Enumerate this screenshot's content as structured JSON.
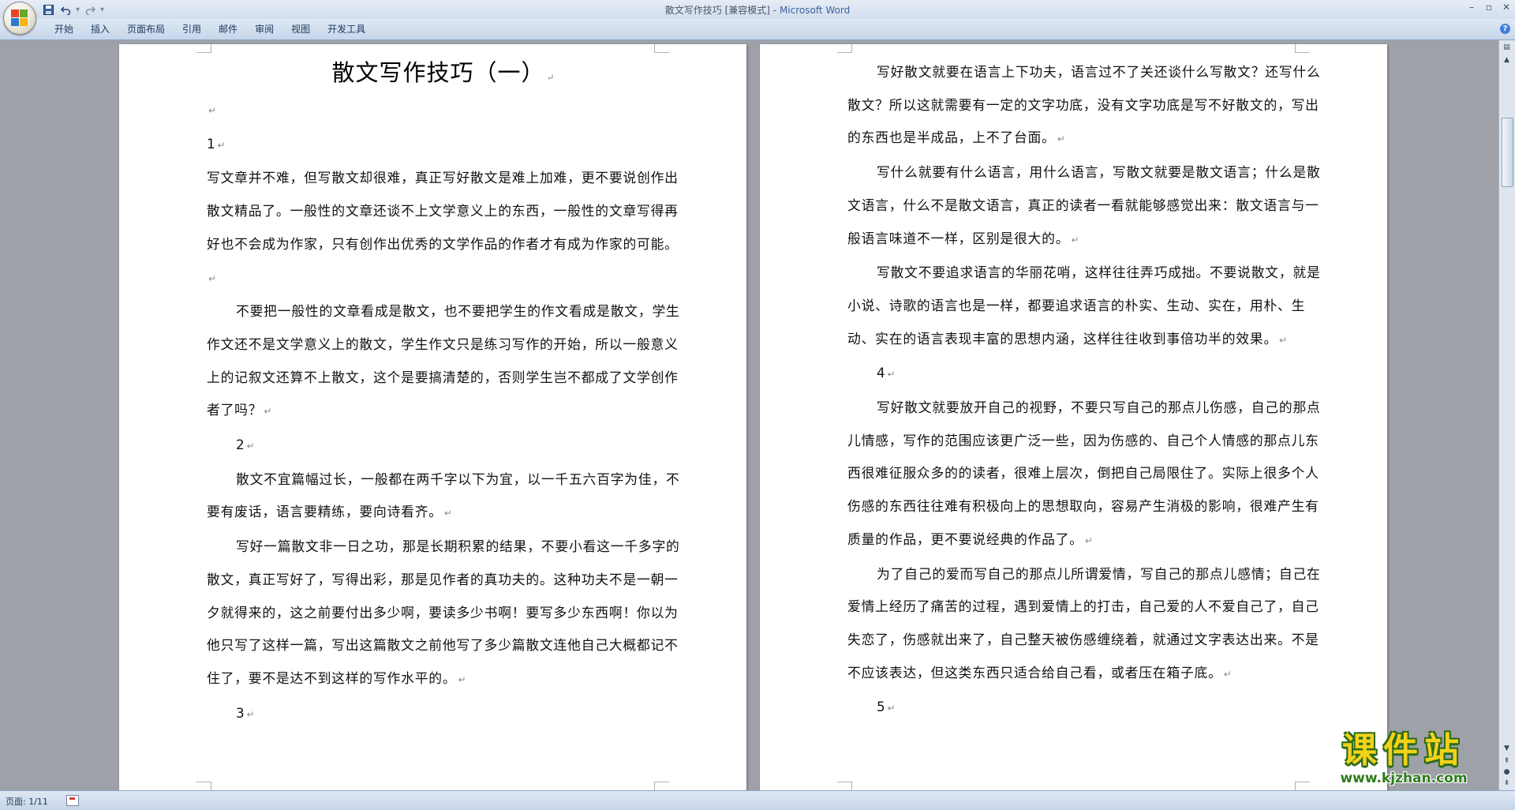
{
  "window": {
    "doc_name": "散文写作技巧 [兼容模式]",
    "separator": " - ",
    "app_name": "Microsoft Word"
  },
  "quick_access": {
    "save_icon": "floppy-disk-icon",
    "undo_icon": "undo-arrow-icon",
    "redo_icon": "redo-arrow-icon",
    "customize_icon": "dropdown-arrow-icon"
  },
  "ribbon_tabs": [
    "开始",
    "插入",
    "页面布局",
    "引用",
    "邮件",
    "审阅",
    "视图",
    "开发工具"
  ],
  "page1": {
    "title": "散文写作技巧（一）",
    "p1": "1",
    "p2": "写文章并不难，但写散文却很难，真正写好散文是难上加难，更不要说创作出散文精品了。一般性的文章还谈不上文学意义上的东西，一般性的文章写得再好也不会成为作家，只有创作出优秀的文学作品的作者才有成为作家的可能。",
    "p3": "不要把一般性的文章看成是散文，也不要把学生的作文看成是散文，学生作文还不是文学意义上的散文，学生作文只是练习写作的开始，所以一般意义上的记叙文还算不上散文，这个是要搞清楚的，否则学生岂不都成了文学创作者了吗？",
    "p4": "2",
    "p5": "散文不宜篇幅过长，一般都在两千字以下为宜，以一千五六百字为佳，不要有废话，语言要精练，要向诗看齐。",
    "p6": "写好一篇散文非一日之功，那是长期积累的结果，不要小看这一千多字的散文，真正写好了，写得出彩，那是见作者的真功夫的。这种功夫不是一朝一夕就得来的，这之前要付出多少啊，要读多少书啊！要写多少东西啊！你以为他只写了这样一篇，写出这篇散文之前他写了多少篇散文连他自己大概都记不住了，要不是达不到这样的写作水平的。",
    "p7": "3"
  },
  "page2": {
    "p1": "写好散文就要在语言上下功夫，语言过不了关还谈什么写散文？还写什么散文？所以这就需要有一定的文字功底，没有文字功底是写不好散文的，写出的东西也是半成品，上不了台面。",
    "p2": "写什么就要有什么语言，用什么语言，写散文就要是散文语言；什么是散文语言，什么不是散文语言，真正的读者一看就能够感觉出来：散文语言与一般语言味道不一样，区别是很大的。",
    "p3": "写散文不要追求语言的华丽花哨，这样往往弄巧成拙。不要说散文，就是小说、诗歌的语言也是一样，都要追求语言的朴实、生动、实在，用朴、生动、实在的语言表现丰富的思想内涵，这样往往收到事倍功半的效果。",
    "p4": "4",
    "p5": "写好散文就要放开自己的视野，不要只写自己的那点儿伤感，自己的那点儿情感，写作的范围应该更广泛一些，因为伤感的、自己个人情感的那点儿东西很难征服众多的的读者，很难上层次，倒把自己局限住了。实际上很多个人伤感的东西往往难有积极向上的思想取向，容易产生消极的影响，很难产生有质量的作品，更不要说经典的作品了。",
    "p6": "为了自己的爱而写自己的那点儿所谓爱情，写自己的那点儿感情；自己在爱情上经历了痛苦的过程，遇到爱情上的打击，自己爱的人不爱自己了，自己失恋了，伤感就出来了，自己整天被伤感缠绕着，就通过文字表达出来。不是不应该表达，但这类东西只适合给自己看，或者压在箱子底。",
    "p7": "5"
  },
  "paragraph_mark": "↵",
  "watermark": {
    "text": "课件站",
    "url": "www.kjzhan.com"
  },
  "statusbar": {
    "page_count": "页面: 1/11"
  },
  "colors": {
    "ribbon_bg": "#d2deec",
    "workspace_bg": "#9ea2a8",
    "title_app": "#3b63a6",
    "watermark_yellow": "#f2d21a",
    "watermark_green": "#2f7b1d"
  }
}
